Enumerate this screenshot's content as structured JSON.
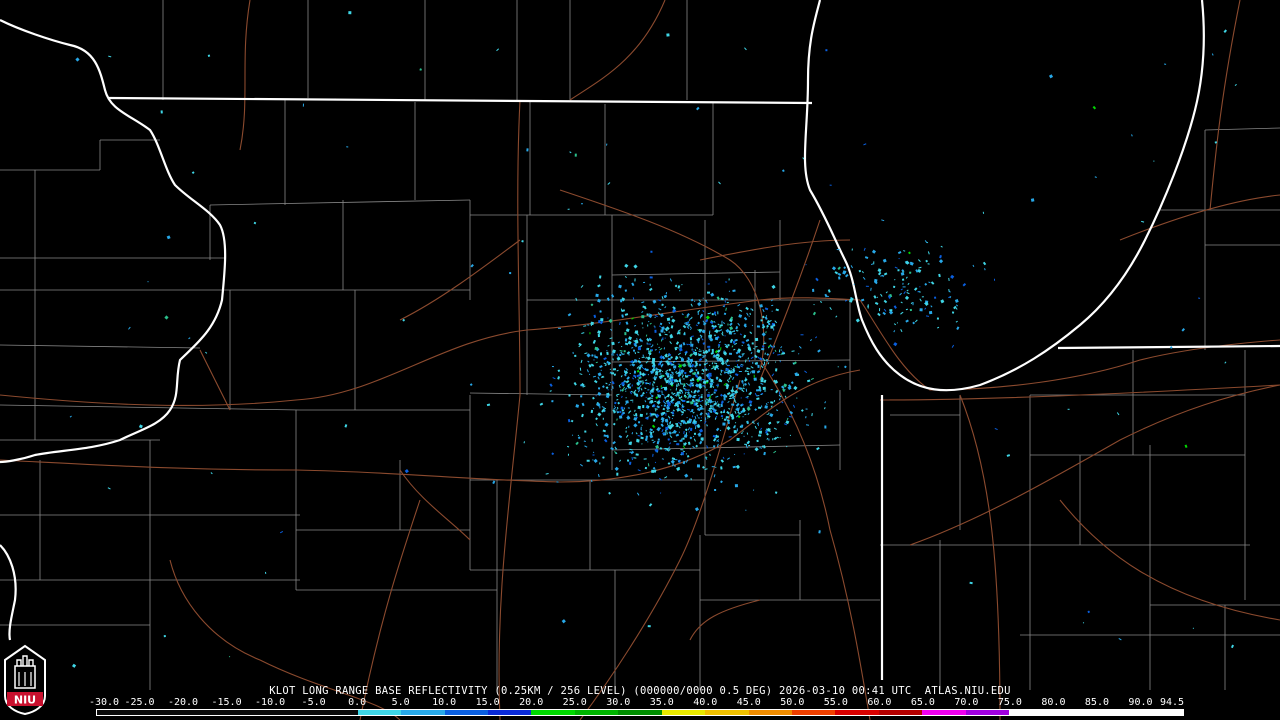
{
  "caption": "KLOT LONG RANGE BASE REFLECTIVITY (0.25KM / 256 LEVEL) (000000/0000 0.5 DEG) 2026-03-10 00:41 UTC  ATLAS.NIU.EDU",
  "scale": {
    "labels": [
      "-30.0",
      "-25.0",
      "-20.0",
      "-15.0",
      "-10.0",
      "-5.0",
      "0.0",
      "5.0",
      "10.0",
      "15.0",
      "20.0",
      "25.0",
      "30.0",
      "35.0",
      "40.0",
      "45.0",
      "50.0",
      "55.0",
      "60.0",
      "65.0",
      "70.0",
      "75.0",
      "80.0",
      "85.0",
      "90.0",
      "94.5"
    ],
    "colors": [
      "#0a0a0a",
      "#0a0a0a",
      "#0a0a0a",
      "#0a0a0a",
      "#0a0a0a",
      "#0a0a0a",
      "#3fd6e6",
      "#27a8e8",
      "#0a5fe0",
      "#0a2ad8",
      "#00d800",
      "#00b400",
      "#008c00",
      "#e8e800",
      "#f0c000",
      "#f08c00",
      "#f04000",
      "#d80000",
      "#b40000",
      "#f000f0",
      "#a000e0",
      "#ffffff",
      "#ffffff",
      "#ffffff",
      "#ffffff"
    ]
  },
  "logo": {
    "text": "NIU",
    "icon": "niu-seal-icon",
    "color": "#c8102e"
  },
  "map": {
    "background": "#000000",
    "colors": {
      "state": "#ffffff",
      "county": "#888888",
      "highway": "#8b4a2e"
    },
    "echo_colors": [
      "#3fd6e6",
      "#27a8e8",
      "#0a5fe0",
      "#2bbf8c",
      "#00d800"
    ]
  }
}
